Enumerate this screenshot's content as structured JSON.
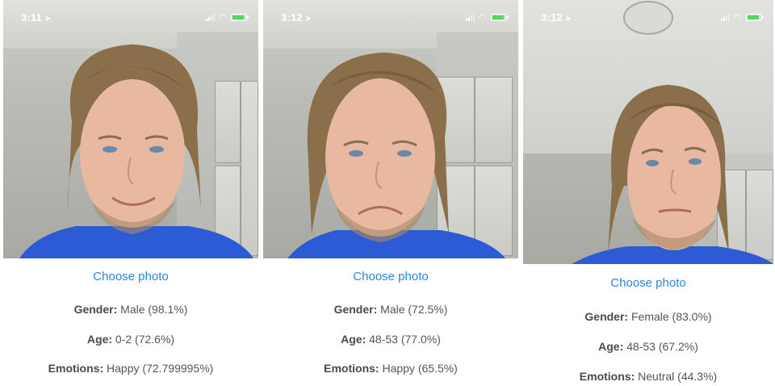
{
  "panels": [
    {
      "status": {
        "time": "3:11"
      },
      "choose_label": "Choose photo",
      "gender": {
        "label": "Gender:",
        "value": " Male (98.1%)"
      },
      "age": {
        "label": "Age:",
        "value": " 0-2 (72.6%)"
      },
      "emotions": {
        "label": "Emotions:",
        "value": " Happy (72.799995%)"
      }
    },
    {
      "status": {
        "time": "3:12"
      },
      "choose_label": "Choose photo",
      "gender": {
        "label": "Gender:",
        "value": " Male (72.5%)"
      },
      "age": {
        "label": "Age:",
        "value": " 48-53 (77.0%)"
      },
      "emotions": {
        "label": "Emotions:",
        "value": " Happy (65.5%)"
      }
    },
    {
      "status": {
        "time": "3:12"
      },
      "choose_label": "Choose photo",
      "gender": {
        "label": "Gender:",
        "value": " Female (83.0%)"
      },
      "age": {
        "label": "Age:",
        "value": " 48-53 (67.2%)"
      },
      "emotions": {
        "label": "Emotions:",
        "value": " Neutral (44.3%)"
      }
    }
  ],
  "colors": {
    "link": "#2f86d8",
    "battery": "#4cd964",
    "shirt": "#2d5bd6"
  },
  "icons": [
    "location-arrow-icon",
    "signal-icon",
    "wifi-icon",
    "battery-icon"
  ]
}
